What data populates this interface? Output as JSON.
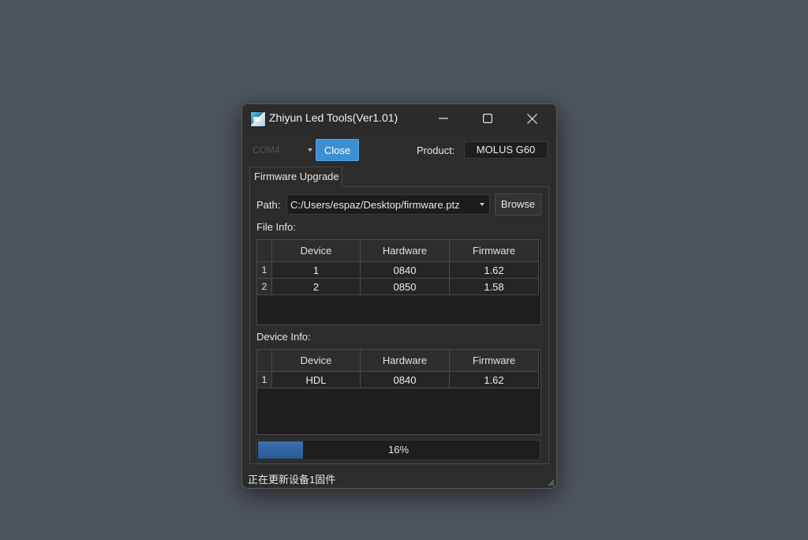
{
  "window": {
    "title": "Zhiyun Led Tools(Ver1.01)"
  },
  "toolbar": {
    "com_port": "COM4",
    "close_label": "Close",
    "product_label": "Product:",
    "product_value": "MOLUS G60"
  },
  "tabs": [
    {
      "label": "Firmware Upgrade",
      "active": true
    }
  ],
  "firmware": {
    "path_label": "Path:",
    "path_value": "C:/Users/espaz/Desktop/firmware.ptz",
    "browse_label": "Browse",
    "file_info_label": "File Info:",
    "device_info_label": "Device Info:",
    "columns": [
      "Device",
      "Hardware",
      "Firmware"
    ],
    "file_rows": [
      {
        "num": "1",
        "device": "1",
        "hardware": "0840",
        "firmware": "1.62"
      },
      {
        "num": "2",
        "device": "2",
        "hardware": "0850",
        "firmware": "1.58"
      }
    ],
    "device_rows": [
      {
        "num": "1",
        "device": "HDL",
        "hardware": "0840",
        "firmware": "1.62"
      }
    ]
  },
  "progress": {
    "value": 0.16,
    "label": "16%"
  },
  "status_text": "正在更新设备1固件",
  "icons": {
    "app": "app-icon",
    "minimize": "minimize-icon",
    "maximize": "maximize-icon",
    "close": "close-icon",
    "dropdown": "chevron-down-icon",
    "grip": "resize-grip-icon"
  },
  "colors": {
    "accent": "#3d8fd3",
    "progress": "#3a6fb0",
    "desktop": "#4d545b"
  }
}
